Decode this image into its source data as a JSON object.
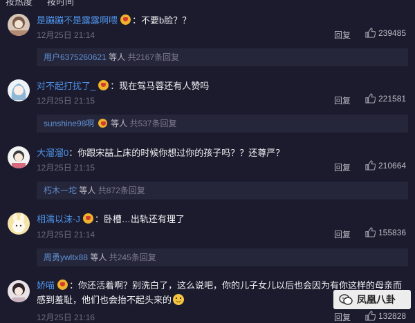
{
  "top_partial": [
    "按热度",
    "按时间"
  ],
  "comments": [
    {
      "username": "是蹦蹦不是露露啊喂",
      "text": "：不要b脸？？",
      "time": "12月25日 21:14",
      "reply_label": "回复",
      "likes": "239485",
      "sub": {
        "user": "用户6375260621",
        "suffix": "等人",
        "count": "共2167条回复"
      }
    },
    {
      "username": "对不起打扰了_",
      "text": "：现在驾马蓉还有人赞吗",
      "time": "12月25日 21:15",
      "reply_label": "回复",
      "likes": "221581",
      "sub": {
        "user": "sunshine98啊",
        "suffix": "等人",
        "count": "共537条回复"
      }
    },
    {
      "username": "大溜溜0",
      "text": "：你跟宋喆上床的时候你想过你的孩子吗？？还尊严？",
      "time": "12月25日 21:15",
      "reply_label": "回复",
      "likes": "210664",
      "sub": {
        "user": "朽木一坨",
        "suffix": "等人",
        "count": "共872条回复"
      }
    },
    {
      "username": "相濡以沫-J",
      "text": "：卧槽…出轨还有理了",
      "time": "12月25日 21:14",
      "reply_label": "回复",
      "likes": "155836",
      "sub": {
        "user": "周勇ywltx88",
        "suffix": "等人",
        "count": "共245条回复"
      }
    },
    {
      "username": "娇喵",
      "text": "：你还活着啊？别洗白了，这么说吧，你的儿子女儿以后也会因为有你这样的母亲而感到羞耻，他们也会抬不起头来的",
      "time": "12月25日 21:16",
      "reply_label": "回复",
      "likes": "132828"
    }
  ],
  "watermark": "凤凰八卦",
  "icons": {
    "thumb": "thumbs-up-icon",
    "badge": "vip-badge-icon",
    "smile": "smile-emoji-icon",
    "wechat": "wechat-icon"
  }
}
